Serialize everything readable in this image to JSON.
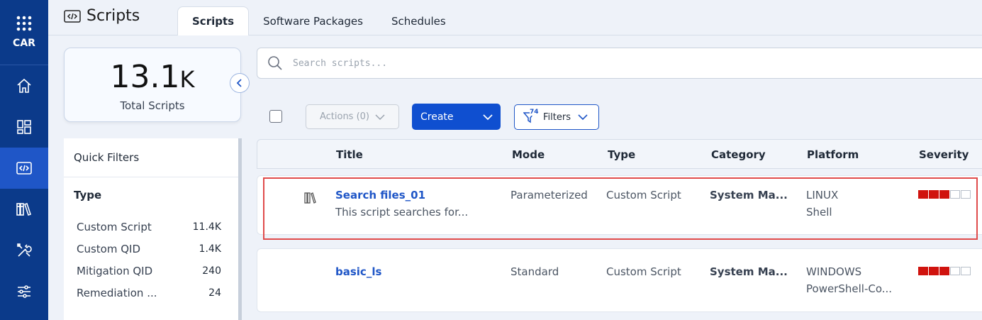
{
  "rail": {
    "org_code": "CAR",
    "items": [
      {
        "icon": "home-icon"
      },
      {
        "icon": "dashboard-icon"
      },
      {
        "icon": "scripts-icon",
        "active": true
      },
      {
        "icon": "library-icon"
      },
      {
        "icon": "tools-icon"
      },
      {
        "icon": "settings-sliders-icon"
      }
    ]
  },
  "header": {
    "title": "Scripts",
    "tabs": [
      {
        "label": "Scripts",
        "active": true
      },
      {
        "label": "Software Packages"
      },
      {
        "label": "Schedules"
      }
    ]
  },
  "stat": {
    "value": "13.1",
    "unit": "K",
    "label": "Total Scripts"
  },
  "quick_filters": {
    "title": "Quick Filters",
    "section": "Type",
    "items": [
      {
        "label": "Custom Script",
        "count": "11.4K"
      },
      {
        "label": "Custom QID",
        "count": "1.4K"
      },
      {
        "label": "Mitigation QID",
        "count": "240"
      },
      {
        "label": "Remediation ...",
        "count": "24"
      }
    ]
  },
  "search": {
    "placeholder": "Search scripts..."
  },
  "toolbar": {
    "actions_label": "Actions (0)",
    "create_label": "Create",
    "filters_label": "Filters",
    "filters_badge": "74"
  },
  "table": {
    "columns": [
      "Title",
      "Mode",
      "Type",
      "Category",
      "Platform",
      "Severity"
    ],
    "rows": [
      {
        "title": "Search files_01",
        "description": "This script searches for...",
        "mode": "Parameterized",
        "type": "Custom Script",
        "category": "System Ma...",
        "platform": "LINUX",
        "platform_sub": "Shell",
        "severity": 3,
        "severity_max": 5
      },
      {
        "title": "basic_ls",
        "description": "",
        "mode": "Standard",
        "type": "Custom Script",
        "category": "System Ma...",
        "platform": "WINDOWS",
        "platform_sub": "PowerShell-Co...",
        "severity": 3,
        "severity_max": 5
      }
    ]
  },
  "colors": {
    "rail_bg": "#0b3a8a",
    "accent": "#0f4fd0",
    "severity_on": "#d0130e",
    "highlight": "#e04b4b"
  }
}
